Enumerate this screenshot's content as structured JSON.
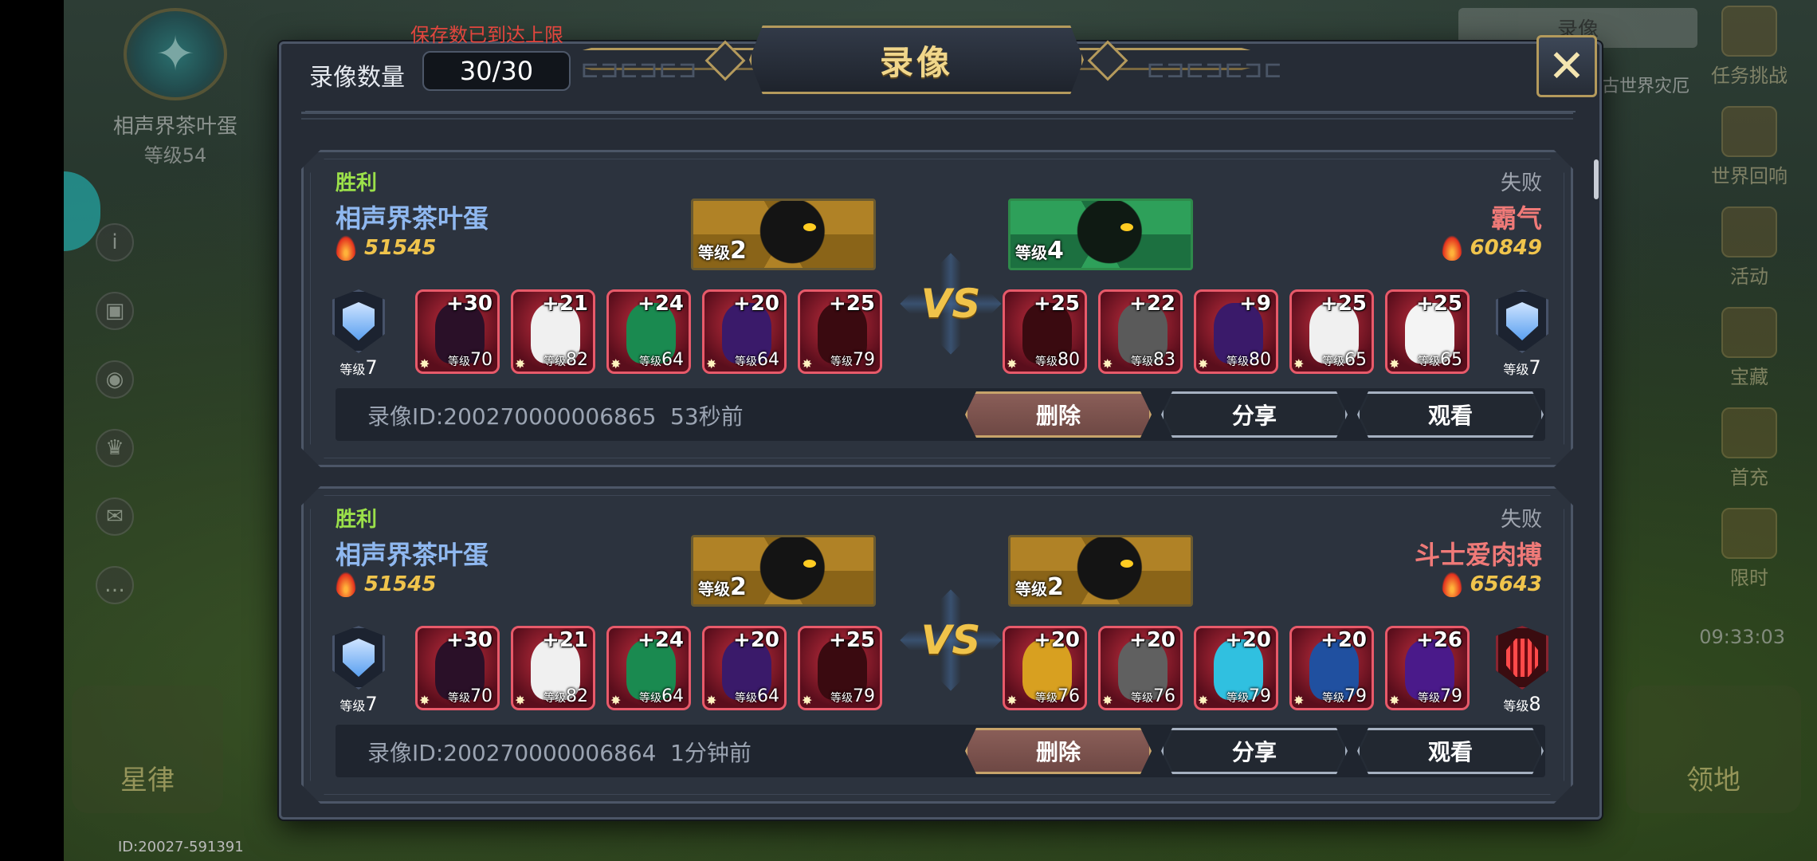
{
  "background": {
    "player_name": "相声界茶叶蛋",
    "player_level": "等级54",
    "account_id": "ID:20027-591391",
    "right_menu": [
      "任务挑战",
      "世界回响",
      "活动",
      "宝藏",
      "首充",
      "限时"
    ],
    "clock": "09:33:03",
    "top_right_badge": "录像",
    "world_disaster": "古世界灾厄",
    "bottom_left": "星律",
    "bottom_right": "领地"
  },
  "dialog": {
    "title": "录像",
    "warning": "保存数已到达上限",
    "count_label": "录像数量",
    "count_value": "30/30",
    "close_icon": "close-x-icon"
  },
  "records": [
    {
      "left": {
        "result": "胜利",
        "name": "相声界茶叶蛋",
        "power": "51545",
        "pet_level_prefix": "等级",
        "pet_level": "2",
        "pet_color": "gold",
        "formation_level_prefix": "等级",
        "formation_level": "7",
        "formation_icon": "blue-shield-icon",
        "heroes": [
          {
            "plus": "+30",
            "lv_prefix": "等级",
            "lv": "70",
            "tint": "#2a1028"
          },
          {
            "plus": "+21",
            "lv_prefix": "等级",
            "lv": "82",
            "tint": "#f0f0f0"
          },
          {
            "plus": "+24",
            "lv_prefix": "等级",
            "lv": "64",
            "tint": "#1a8a50"
          },
          {
            "plus": "+20",
            "lv_prefix": "等级",
            "lv": "64",
            "tint": "#3a1a6a"
          },
          {
            "plus": "+25",
            "lv_prefix": "等级",
            "lv": "79",
            "tint": "#3a0a10"
          }
        ]
      },
      "vs": "VS",
      "right": {
        "result": "失败",
        "name": "霸气",
        "power": "60849",
        "pet_level_prefix": "等级",
        "pet_level": "4",
        "pet_color": "green",
        "formation_level_prefix": "等级",
        "formation_level": "7",
        "formation_icon": "blue-shield-icon",
        "heroes": [
          {
            "plus": "+25",
            "lv_prefix": "等级",
            "lv": "80",
            "tint": "#3a0a10"
          },
          {
            "plus": "+22",
            "lv_prefix": "等级",
            "lv": "83",
            "tint": "#5a5a5a"
          },
          {
            "plus": "+9",
            "lv_prefix": "等级",
            "lv": "80",
            "tint": "#3a1a6a"
          },
          {
            "plus": "+25",
            "lv_prefix": "等级",
            "lv": "65",
            "tint": "#f0f0f0"
          },
          {
            "plus": "+25",
            "lv_prefix": "等级",
            "lv": "65",
            "tint": "#f4f4f4"
          }
        ]
      },
      "record_id": "录像ID:200270000006865",
      "time_ago": "53秒前",
      "buttons": {
        "delete": "删除",
        "share": "分享",
        "watch": "观看"
      }
    },
    {
      "left": {
        "result": "胜利",
        "name": "相声界茶叶蛋",
        "power": "51545",
        "pet_level_prefix": "等级",
        "pet_level": "2",
        "pet_color": "gold",
        "formation_level_prefix": "等级",
        "formation_level": "7",
        "formation_icon": "blue-shield-icon",
        "heroes": [
          {
            "plus": "+30",
            "lv_prefix": "等级",
            "lv": "70",
            "tint": "#2a1028"
          },
          {
            "plus": "+21",
            "lv_prefix": "等级",
            "lv": "82",
            "tint": "#f0f0f0"
          },
          {
            "plus": "+24",
            "lv_prefix": "等级",
            "lv": "64",
            "tint": "#1a8a50"
          },
          {
            "plus": "+20",
            "lv_prefix": "等级",
            "lv": "64",
            "tint": "#3a1a6a"
          },
          {
            "plus": "+25",
            "lv_prefix": "等级",
            "lv": "79",
            "tint": "#3a0a10"
          }
        ]
      },
      "vs": "VS",
      "right": {
        "result": "失败",
        "name": "斗士爱肉搏",
        "power": "65643",
        "pet_level_prefix": "等级",
        "pet_level": "2",
        "pet_color": "gold",
        "formation_level_prefix": "等级",
        "formation_level": "8",
        "formation_icon": "red-formation-icon",
        "heroes": [
          {
            "plus": "+20",
            "lv_prefix": "等级",
            "lv": "76",
            "tint": "#d8a020"
          },
          {
            "plus": "+20",
            "lv_prefix": "等级",
            "lv": "76",
            "tint": "#606060"
          },
          {
            "plus": "+20",
            "lv_prefix": "等级",
            "lv": "79",
            "tint": "#30c0e0"
          },
          {
            "plus": "+20",
            "lv_prefix": "等级",
            "lv": "79",
            "tint": "#2050a0"
          },
          {
            "plus": "+26",
            "lv_prefix": "等级",
            "lv": "79",
            "tint": "#4a1a8a"
          }
        ]
      },
      "record_id": "录像ID:200270000006864",
      "time_ago": "1分钟前",
      "buttons": {
        "delete": "删除",
        "share": "分享",
        "watch": "观看"
      }
    }
  ]
}
